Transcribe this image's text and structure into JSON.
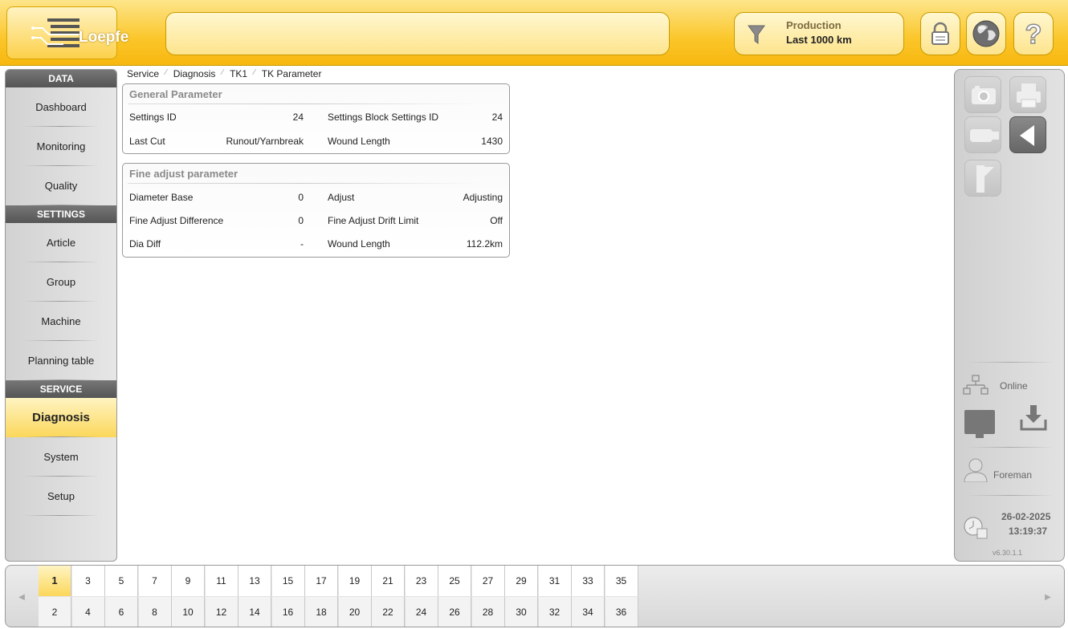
{
  "header": {
    "logo_text": "Loepfe",
    "filter_title": "Production",
    "filter_value": "Last 1000 km",
    "buttons": [
      "lock-icon",
      "globe-icon",
      "help-icon"
    ],
    "accent_color": "#fbc62a"
  },
  "nav": {
    "sections": [
      {
        "title": "DATA",
        "items": [
          "Dashboard",
          "Monitoring",
          "Quality"
        ]
      },
      {
        "title": "SETTINGS",
        "items": [
          "Article",
          "Group",
          "Machine",
          "Planning table"
        ]
      },
      {
        "title": "SERVICE",
        "items": [
          "Diagnosis",
          "System",
          "Setup"
        ]
      }
    ],
    "active_item": "Diagnosis"
  },
  "breadcrumb": [
    "Service",
    "Diagnosis",
    "TK1",
    "TK Parameter"
  ],
  "general_parameter": {
    "title": "General Parameter",
    "rows": [
      {
        "label": "Settings ID",
        "value": "24",
        "label2": "Settings Block Settings ID",
        "value2": "24"
      },
      {
        "label": "Last Cut",
        "value": "Runout/Yarnbreak",
        "label2": "Wound Length",
        "value2": "1430"
      }
    ]
  },
  "fine_adjust": {
    "title": "Fine adjust parameter",
    "rows": [
      {
        "label": "Diameter Base",
        "value": "0",
        "label2": "Adjust",
        "value2": "Adjusting"
      },
      {
        "label": "Fine Adjust Difference",
        "value": "0",
        "label2": "Fine Adjust Drift Limit",
        "value2": "Off"
      },
      {
        "label": "Dia Diff",
        "value": "-",
        "label2": "Wound Length",
        "value2": "112.2km"
      }
    ]
  },
  "rightpanel": {
    "icons": [
      "camera-icon",
      "printer-icon",
      "usb-icon",
      "back-icon",
      "ruler-icon"
    ],
    "online_label": "Online",
    "user_label": "Foreman",
    "date": "26-02-2025",
    "time": "13:19:37",
    "version": "v6.30.1.1"
  },
  "positions": {
    "top": [
      "1",
      "3",
      "5",
      "7",
      "9",
      "11",
      "13",
      "15",
      "17",
      "19",
      "21",
      "23",
      "25",
      "27",
      "29",
      "31",
      "33",
      "35"
    ],
    "bottom": [
      "2",
      "4",
      "6",
      "8",
      "10",
      "12",
      "14",
      "16",
      "18",
      "20",
      "22",
      "24",
      "26",
      "28",
      "30",
      "32",
      "34",
      "36"
    ],
    "active": "1"
  }
}
